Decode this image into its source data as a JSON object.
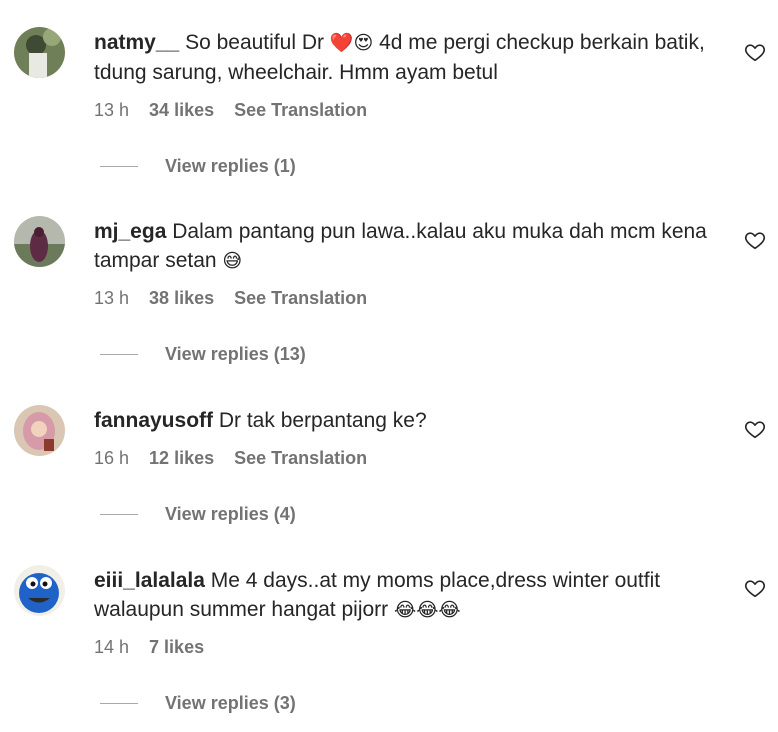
{
  "comments": [
    {
      "username": "natmy__",
      "text_before": "So beautiful Dr ",
      "emoji": "❤️😍",
      "text_after": " 4d me pergi checkup berkain batik, tdung sarung, wheelchair. Hmm ayam betul",
      "time": "13 h",
      "likes": "34 likes",
      "translate": "See Translation",
      "replies": "View replies (1)"
    },
    {
      "username": "mj_ega",
      "text_before": "Dalam pantang pun lawa..kalau aku muka dah mcm kena tampar setan ",
      "emoji": "😅",
      "text_after": "",
      "time": "13 h",
      "likes": "38 likes",
      "translate": "See Translation",
      "replies": "View replies (13)"
    },
    {
      "username": "fannayusoff",
      "text_before": "Dr tak berpantang ke?",
      "emoji": "",
      "text_after": "",
      "time": "16 h",
      "likes": "12 likes",
      "translate": "See Translation",
      "replies": "View replies (4)"
    },
    {
      "username": "eiii_lalalala",
      "text_before": "Me 4 days..at my moms place,dress winter outfit walaupun summer hangat pijorr ",
      "emoji": "😂😂😂",
      "text_after": "",
      "time": "14 h",
      "likes": "7 likes",
      "translate": "",
      "replies": "View replies (3)"
    }
  ],
  "icons": {
    "like": "heart-outline-icon",
    "avatar": "user-avatar"
  },
  "colors": {
    "text": "#262626",
    "secondary": "#737373",
    "divider": "#a8a8a8"
  }
}
